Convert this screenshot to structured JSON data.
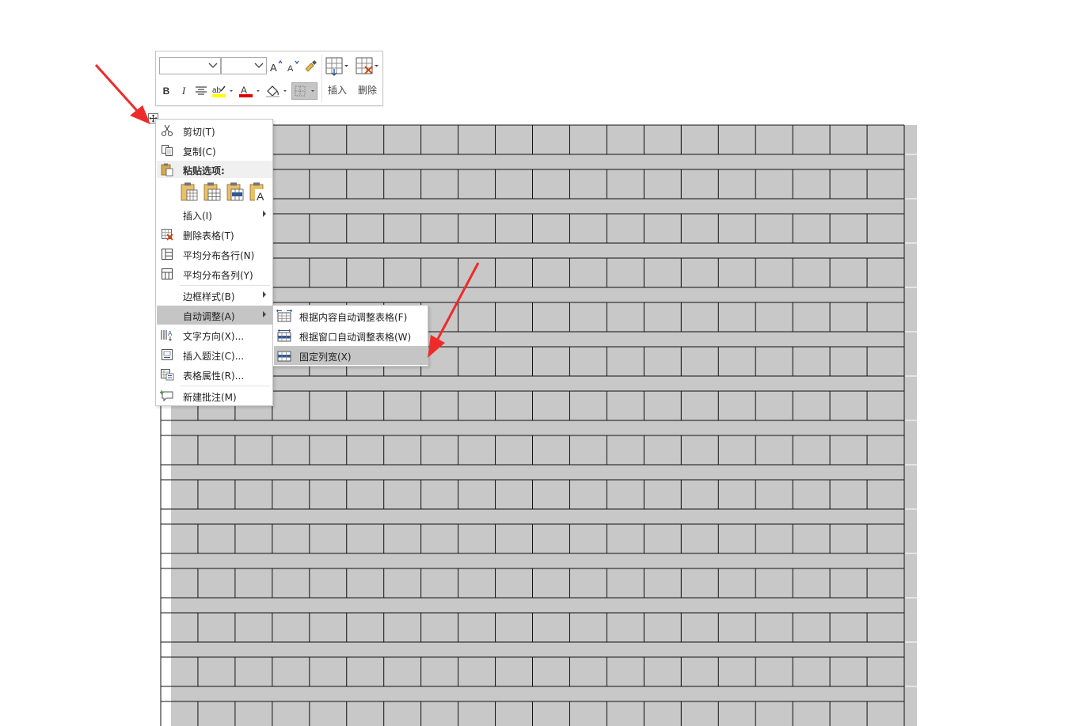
{
  "toolbar": {
    "font_name": "",
    "font_size": "",
    "grow_font_icon": "font-grow-icon",
    "shrink_font_icon": "font-shrink-icon",
    "format_painter_icon": "format-painter-icon",
    "bold": "B",
    "italic": "I",
    "insert_label": "插入",
    "delete_label": "删除",
    "highlight_color": "#ffff00",
    "font_color": "#e00000"
  },
  "context_menu": {
    "cut": "剪切(T)",
    "copy": "复制(C)",
    "paste_options": "粘贴选项:",
    "insert": "插入(I)",
    "delete_table": "删除表格(T)",
    "distribute_rows": "平均分布各行(N)",
    "distribute_cols": "平均分布各列(Y)",
    "border_styles": "边框样式(B)",
    "autofit": "自动调整(A)",
    "text_direction": "文字方向(X)...",
    "insert_caption": "插入题注(C)...",
    "table_properties": "表格属性(R)...",
    "new_comment": "新建批注(M)"
  },
  "autofit_submenu": {
    "fit_contents": "根据内容自动调整表格(F)",
    "fit_window": "根据窗口自动调整表格(W)",
    "fixed_width": "固定列宽(X)"
  },
  "colors": {
    "table_fill": "#c8c8c8",
    "menu_highlight": "#c5c5c5",
    "arrow": "#ee2b2b"
  }
}
